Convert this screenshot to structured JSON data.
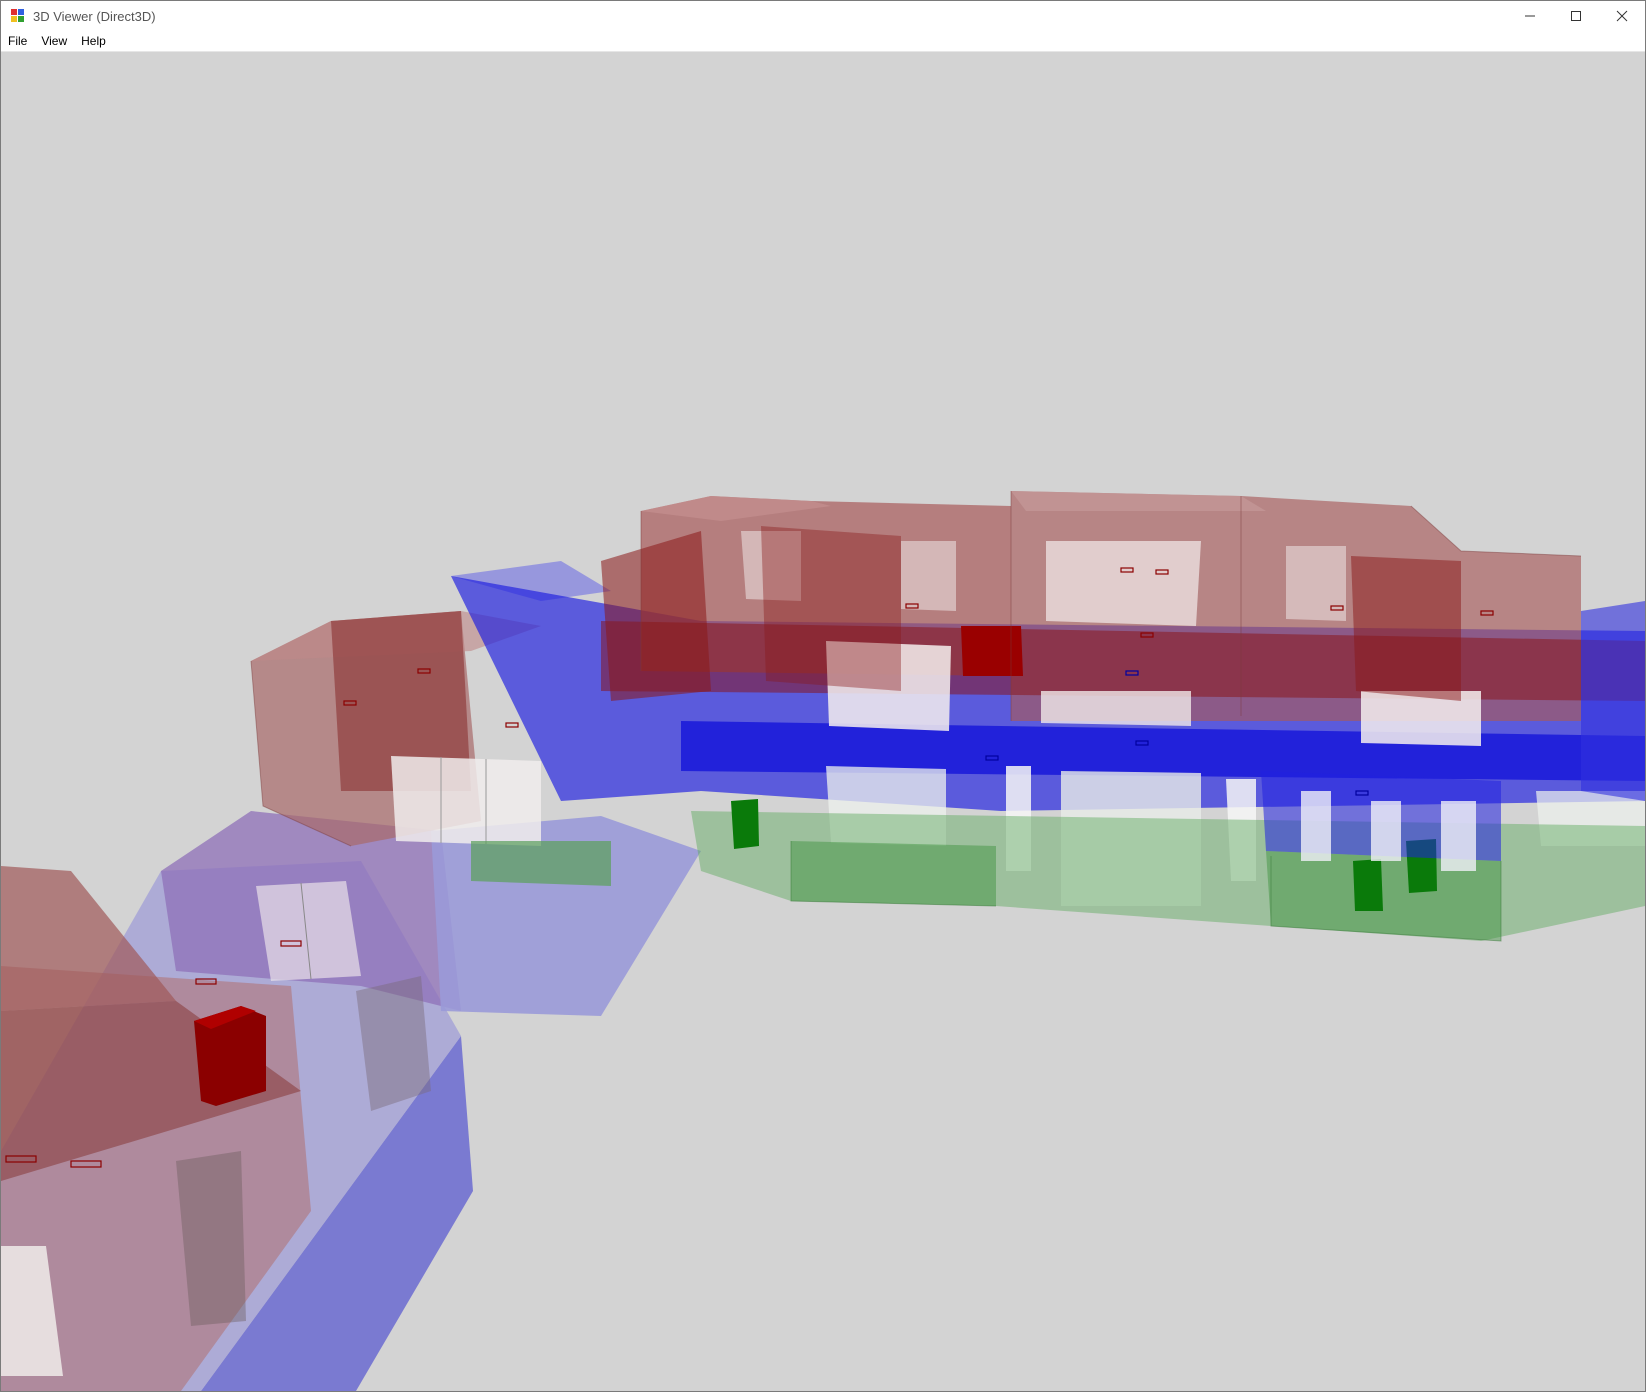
{
  "window": {
    "title": "3D Viewer (Direct3D)"
  },
  "menu": {
    "items": [
      {
        "label": "File"
      },
      {
        "label": "View"
      },
      {
        "label": "Help"
      }
    ]
  },
  "controls": {
    "minimize_icon": "minimize-icon",
    "maximize_icon": "maximize-icon",
    "close_icon": "close-icon"
  },
  "colors": {
    "background": "#d3d3d3",
    "red_zone": "#8b0000",
    "blue_zone": "#1010e0",
    "green_zone": "#108a10",
    "white_panel": "#f2f2f2"
  }
}
